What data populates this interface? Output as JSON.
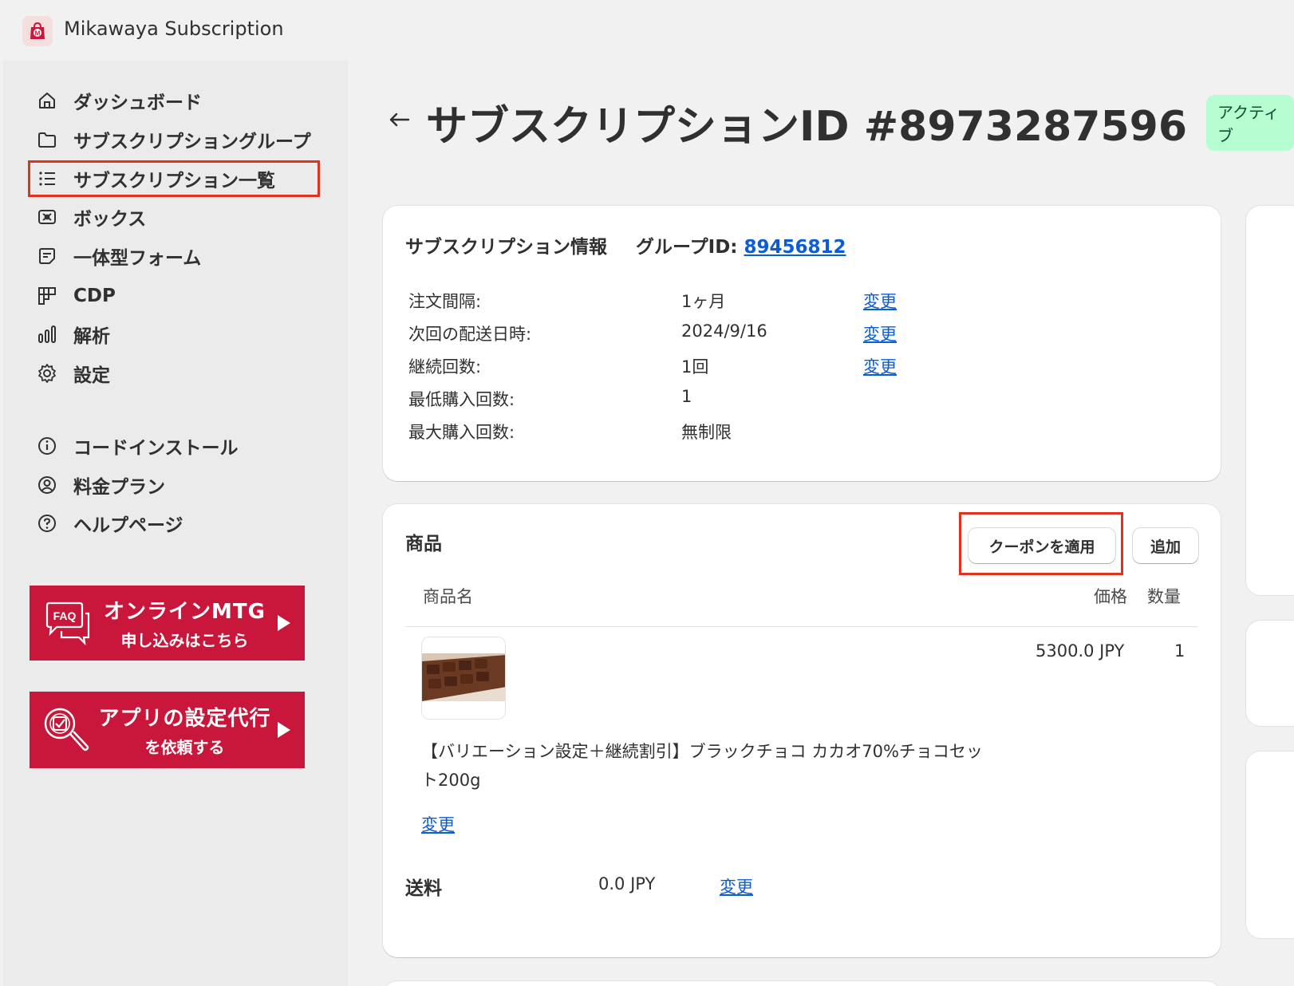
{
  "app": {
    "title": "Mikawaya Subscription"
  },
  "sidebar": {
    "items": [
      {
        "label": "ダッシュボード",
        "icon": "home-icon"
      },
      {
        "label": "サブスクリプショングループ",
        "icon": "folder-icon"
      },
      {
        "label": "サブスクリプション一覧",
        "icon": "list-icon",
        "selected": true
      },
      {
        "label": "ボックス",
        "icon": "box-icon"
      },
      {
        "label": "一体型フォーム",
        "icon": "form-icon"
      },
      {
        "label": "CDP",
        "icon": "grid-icon"
      },
      {
        "label": "解析",
        "icon": "analytics-icon"
      },
      {
        "label": "設定",
        "icon": "gear-icon"
      },
      {
        "label": "コードインストール",
        "icon": "info-icon"
      },
      {
        "label": "料金プラン",
        "icon": "user-circle-icon"
      },
      {
        "label": "ヘルプページ",
        "icon": "help-icon"
      }
    ],
    "promo_mtg": {
      "icon_text": "FAQ",
      "title": "オンラインMTG",
      "subtitle": "申し込みはこちら"
    },
    "promo_setup": {
      "title": "アプリの設定代行",
      "subtitle": "を依頼する"
    }
  },
  "header": {
    "title": "サブスクリプションID #8973287596",
    "status": "アクティブ"
  },
  "info": {
    "heading": "サブスクリプション情報",
    "group_label": "グループID:",
    "group_id": "89456812",
    "rows": [
      {
        "label": "注文間隔:",
        "value": "1ヶ月",
        "action": "変更"
      },
      {
        "label": "次回の配送日時:",
        "value": "2024/9/16",
        "action": "変更"
      },
      {
        "label": "継続回数:",
        "value": "1回",
        "action": "変更"
      },
      {
        "label": "最低購入回数:",
        "value": "1",
        "action": ""
      },
      {
        "label": "最大購入回数:",
        "value": "無制限",
        "action": ""
      }
    ]
  },
  "products": {
    "heading": "商品",
    "coupon_button": "クーポンを適用",
    "add_button": "追加",
    "columns": {
      "name": "商品名",
      "price": "価格",
      "qty": "数量"
    },
    "item": {
      "name": "【バリエーション設定＋継続割引】ブラックチョコ カカオ70%チョコセット200g",
      "price": "5300.0 JPY",
      "qty": "1",
      "change": "変更"
    },
    "shipping": {
      "label": "送料",
      "value": "0.0 JPY",
      "change": "変更"
    }
  },
  "colors": {
    "accent": "#c8173a",
    "highlight": "#e0331f",
    "link": "#0b5cd5",
    "badge_bg": "#b4fed2"
  }
}
